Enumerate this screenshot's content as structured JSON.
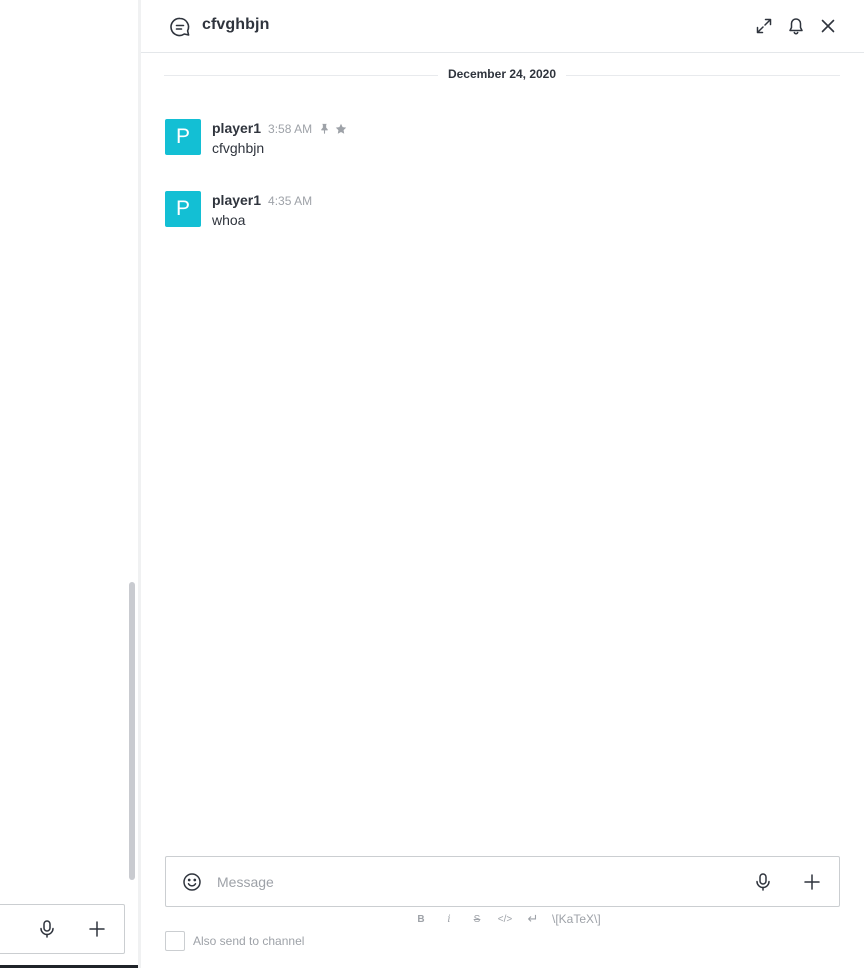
{
  "thread": {
    "title": "cfvghbjn",
    "date_divider": "December 24, 2020",
    "messages": [
      {
        "avatar_letter": "P",
        "avatar_color": "#13bfd4",
        "user": "player1",
        "time": "3:58 AM",
        "text": "cfvghbjn",
        "pinned": true,
        "starred": true
      },
      {
        "avatar_letter": "P",
        "avatar_color": "#13bfd4",
        "user": "player1",
        "time": "4:35 AM",
        "text": "whoa",
        "pinned": false,
        "starred": false
      }
    ],
    "header_icons": [
      "thread-icon",
      "expand-icon",
      "bell-icon",
      "close-icon"
    ]
  },
  "composer": {
    "placeholder": "Message",
    "value": "",
    "icons": [
      "emoji-icon",
      "microphone-icon",
      "plus-icon"
    ],
    "format_buttons": [
      {
        "label": "B",
        "name": "bold"
      },
      {
        "label": "i",
        "name": "italic"
      },
      {
        "label": "S",
        "name": "strike"
      },
      {
        "label": "</>",
        "name": "code"
      },
      {
        "label": "↵",
        "name": "multiline"
      }
    ],
    "katex_label": "\\[KaTeX\\]",
    "also_send_label": "Also send to channel",
    "also_send_checked": false
  },
  "left_composer": {
    "icons": [
      "microphone-icon",
      "plus-icon"
    ]
  },
  "colors": {
    "accent": "#13bfd4",
    "text": "#2f343d",
    "muted": "#9ea2a8",
    "border": "#cbced1"
  }
}
